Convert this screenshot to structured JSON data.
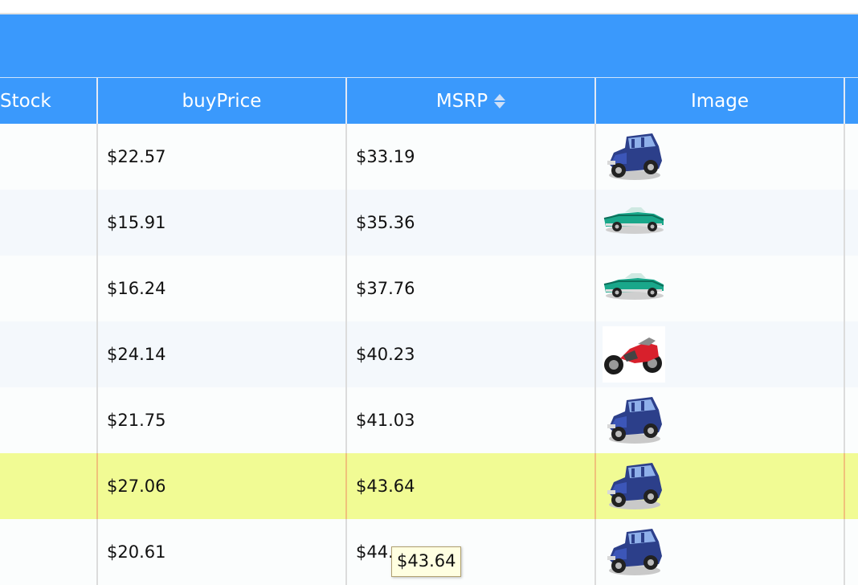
{
  "table": {
    "headers": {
      "stock": "Stock",
      "buy_price": "buyPrice",
      "msrp": "MSRP",
      "image": "Image"
    },
    "rows": [
      {
        "buy_price": "$22.57",
        "msrp": "$33.19",
        "image": "vintage-blue-car"
      },
      {
        "buy_price": "$15.91",
        "msrp": "$35.36",
        "image": "green-convertible-car"
      },
      {
        "buy_price": "$16.24",
        "msrp": "$37.76",
        "image": "green-convertible-car"
      },
      {
        "buy_price": "$24.14",
        "msrp": "$40.23",
        "image": "red-motorcycle"
      },
      {
        "buy_price": "$21.75",
        "msrp": "$41.03",
        "image": "vintage-blue-car"
      },
      {
        "buy_price": "$27.06",
        "msrp": "$43.64",
        "image": "vintage-blue-car"
      },
      {
        "buy_price": "$20.61",
        "msrp": "$44.",
        "image": "vintage-blue-car"
      }
    ],
    "sorted_column": "MSRP"
  },
  "tooltip": {
    "text": "$43.64"
  },
  "colors": {
    "header": "#3a99fc",
    "row_selected": "#f1fb94",
    "row_alt": "#f4f8fc",
    "tooltip_bg": "#ffffe1"
  }
}
